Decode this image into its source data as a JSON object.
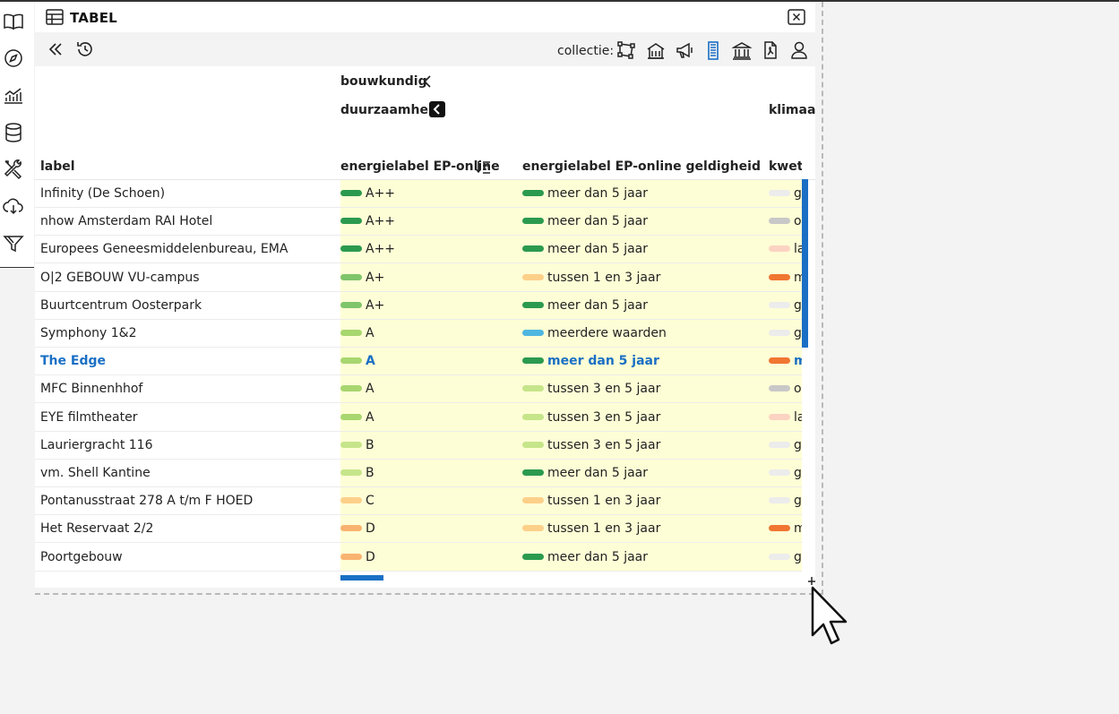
{
  "panel": {
    "title": "TABEL"
  },
  "toolbar": {
    "collection_label": "collectie:",
    "buttons": [
      "double-chevron-left-icon",
      "history-icon"
    ],
    "collection_icons": [
      "polygon-icon",
      "building-icon",
      "megaphone-icon",
      "skyscraper-icon",
      "bank-icon",
      "document-icon",
      "user-icon"
    ],
    "active_collection": "skyscraper-icon"
  },
  "rail": {
    "icons": [
      "book-icon",
      "compass-icon",
      "chart-icon",
      "database-icon",
      "tools-icon",
      "cloud-download-icon",
      "filter-icon"
    ]
  },
  "table": {
    "groups": {
      "top": "bouwkundig",
      "sub": "duurzaamheid",
      "next": "klimaa"
    },
    "columns": {
      "label": "label",
      "energielabel": "energielabel EP-online",
      "geldigheid": "energielabel EP-online geldigheid",
      "kwets": "kwetsb"
    },
    "rows": [
      {
        "label": "Infinity (De Schoen)",
        "energy": "A++",
        "energy_color": "#2b9a4f",
        "validity": "meer dan 5 jaar",
        "validity_color": "#2b9a4f",
        "kw": "g",
        "kw_color": "#ececec"
      },
      {
        "label": "nhow Amsterdam RAI Hotel",
        "energy": "A++",
        "energy_color": "#2b9a4f",
        "validity": "meer dan 5 jaar",
        "validity_color": "#2b9a4f",
        "kw": "o",
        "kw_color": "#c8c8c8"
      },
      {
        "label": "Europees Geneesmiddelenbureau, EMA",
        "energy": "A++",
        "energy_color": "#2b9a4f",
        "validity": "meer dan 5 jaar",
        "validity_color": "#2b9a4f",
        "kw": "la",
        "kw_color": "#fbd3c2"
      },
      {
        "label": "O|2 GEBOUW VU-campus",
        "energy": "A+",
        "energy_color": "#7fc56a",
        "validity": "tussen 1 en 3 jaar",
        "validity_color": "#fdd08a",
        "kw": "m",
        "kw_color": "#f07632"
      },
      {
        "label": "Buurtcentrum Oosterpark",
        "energy": "A+",
        "energy_color": "#7fc56a",
        "validity": "meer dan 5 jaar",
        "validity_color": "#2b9a4f",
        "kw": "g",
        "kw_color": "#ececec"
      },
      {
        "label": "Symphony 1&2",
        "energy": "A",
        "energy_color": "#a8d66f",
        "validity": "meerdere waarden",
        "validity_color": "#4fb6e0",
        "kw": "g",
        "kw_color": "#ececec"
      },
      {
        "label": "The Edge",
        "energy": "A",
        "energy_color": "#a8d66f",
        "validity": "meer dan 5 jaar",
        "validity_color": "#2b9a4f",
        "kw": "m",
        "kw_color": "#f07632",
        "highlight": true
      },
      {
        "label": "MFC Binnenhhof",
        "energy": "A",
        "energy_color": "#a8d66f",
        "validity": "tussen 3 en 5 jaar",
        "validity_color": "#c6e58a",
        "kw": "o",
        "kw_color": "#c8c8c8"
      },
      {
        "label": "EYE filmtheater",
        "energy": "A",
        "energy_color": "#a8d66f",
        "validity": "tussen 3 en 5 jaar",
        "validity_color": "#c6e58a",
        "kw": "la",
        "kw_color": "#fbd3c2"
      },
      {
        "label": "Lauriergracht 116",
        "energy": "B",
        "energy_color": "#c6e58a",
        "validity": "tussen 3 en 5 jaar",
        "validity_color": "#c6e58a",
        "kw": "g",
        "kw_color": "#ececec"
      },
      {
        "label": "vm. Shell Kantine",
        "energy": "B",
        "energy_color": "#c6e58a",
        "validity": "meer dan 5 jaar",
        "validity_color": "#2b9a4f",
        "kw": "g",
        "kw_color": "#ececec"
      },
      {
        "label": "Pontanusstraat 278 A t/m F HOED",
        "energy": "C",
        "energy_color": "#fdd08a",
        "validity": "tussen 1 en 3 jaar",
        "validity_color": "#fdd08a",
        "kw": "g",
        "kw_color": "#ececec"
      },
      {
        "label": "Het Reservaat 2/2",
        "energy": "D",
        "energy_color": "#f9b370",
        "validity": "tussen 1 en 3 jaar",
        "validity_color": "#fdd08a",
        "kw": "m",
        "kw_color": "#f07632"
      },
      {
        "label": "Poortgebouw",
        "energy": "D",
        "energy_color": "#f9b370",
        "validity": "meer dan 5 jaar",
        "validity_color": "#2b9a4f",
        "kw": "g",
        "kw_color": "#ececec"
      }
    ]
  }
}
